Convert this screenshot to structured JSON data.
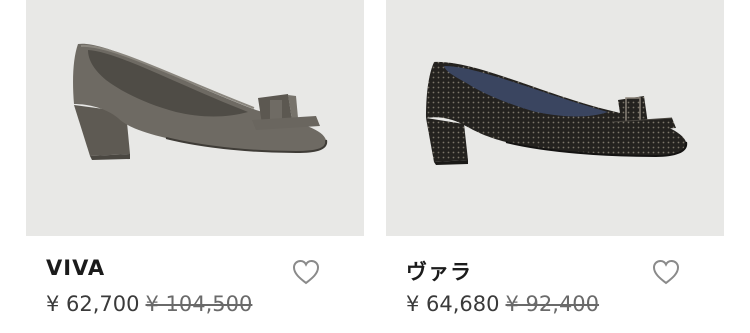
{
  "products": [
    {
      "name": "VIVA",
      "price": "¥ 62,700",
      "original_price": "¥ 104,500",
      "image_icon": "gray-leather-bow-pump-image",
      "wishlist_icon": "heart-outline-icon"
    },
    {
      "name": "ヴァラ",
      "price": "¥ 64,680",
      "original_price": "¥ 92,400",
      "image_icon": "black-dotted-suede-bow-pump-image",
      "wishlist_icon": "heart-outline-icon"
    }
  ],
  "colors": {
    "image_background": "#e8e8e6",
    "shoe_gray": "#6b675f",
    "shoe_black": "#1f1e1c",
    "heart_stroke": "#888888"
  }
}
